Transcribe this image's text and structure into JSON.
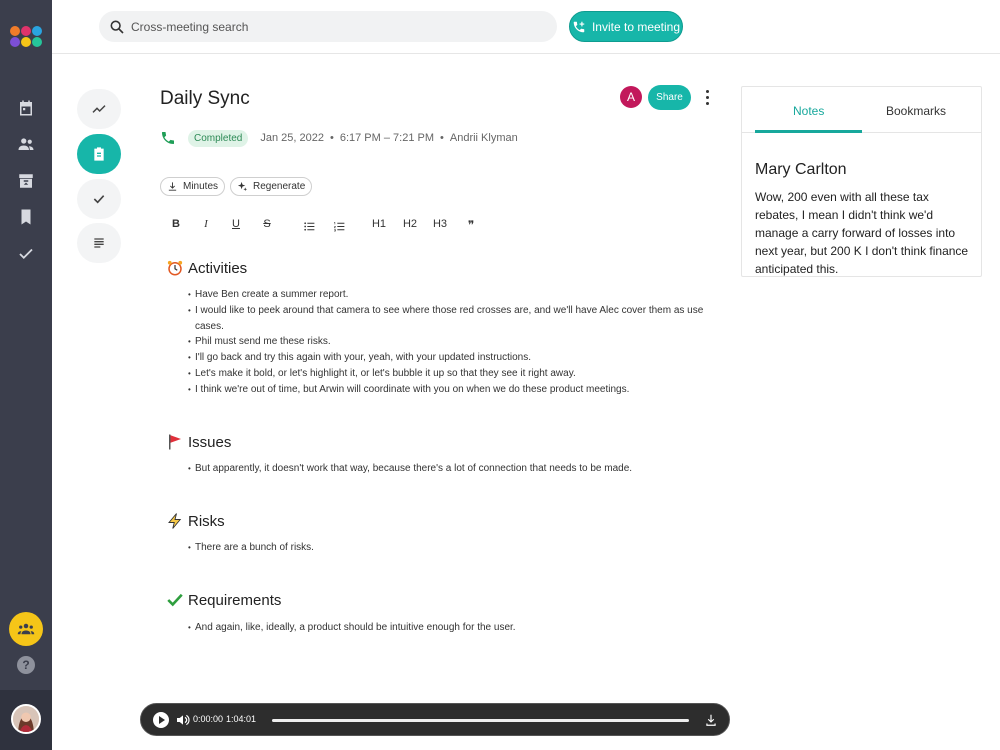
{
  "search": {
    "placeholder": "Cross-meeting search"
  },
  "invite": {
    "label": "Invite to meeting"
  },
  "meeting": {
    "title": "Daily Sync",
    "status": "Completed",
    "date": "Jan 25, 2022",
    "time_range": "6:17 PM – 7:21 PM",
    "organizer": "Andrii Klyman",
    "participant_initial": "A",
    "share_label": "Share"
  },
  "actions": {
    "minutes": "Minutes",
    "regenerate": "Regenerate"
  },
  "toolbar": {
    "bold": "B",
    "italic": "I",
    "underline": "U",
    "strike": "S",
    "h1": "H1",
    "h2": "H2",
    "h3": "H3",
    "quote": "❞"
  },
  "sections": [
    {
      "heading": "Activities",
      "icon": "alarm-clock-icon",
      "items": [
        "Have Ben create a summer report.",
        "I would like to peek around that camera to see where those red crosses are, and we'll have Alec cover them as use cases.",
        "Phil must send me these risks.",
        "I'll go back and try this again with your, yeah, with your updated instructions.",
        "Let's make it bold, or let's highlight it, or let's bubble it up so that they see it right away.",
        "I think we're out of time, but Arwin will coordinate with you on when we do these product meetings."
      ]
    },
    {
      "heading": "Issues",
      "icon": "red-flag-icon",
      "items": [
        "But apparently, it doesn't work that way, because there's a lot of connection that needs to be made."
      ]
    },
    {
      "heading": "Risks",
      "icon": "lightning-icon",
      "items": [
        "There are a bunch of risks."
      ]
    },
    {
      "heading": "Requirements",
      "icon": "checkmark-icon",
      "items": [
        "And again, like, ideally, a product should be intuitive enough for the user."
      ]
    }
  ],
  "panel": {
    "tabs": [
      "Notes",
      "Bookmarks"
    ],
    "active_tab": "Notes",
    "speaker": "Mary Carlton",
    "quote": "Wow, 200 even with all these tax rebates, I mean I didn't think we'd manage a carry forward of losses into next year, but 200 K I don't think finance anticipated this."
  },
  "player": {
    "current": "0:00:00",
    "duration": "1:04:01",
    "progress": 0
  },
  "colors": {
    "accent": "#17b6a9",
    "sidebar": "#3b3e4c",
    "status_bg": "#dff3e7",
    "status_text": "#2d8a56",
    "avatar": "#c2185b",
    "team_button": "#f5c518"
  }
}
